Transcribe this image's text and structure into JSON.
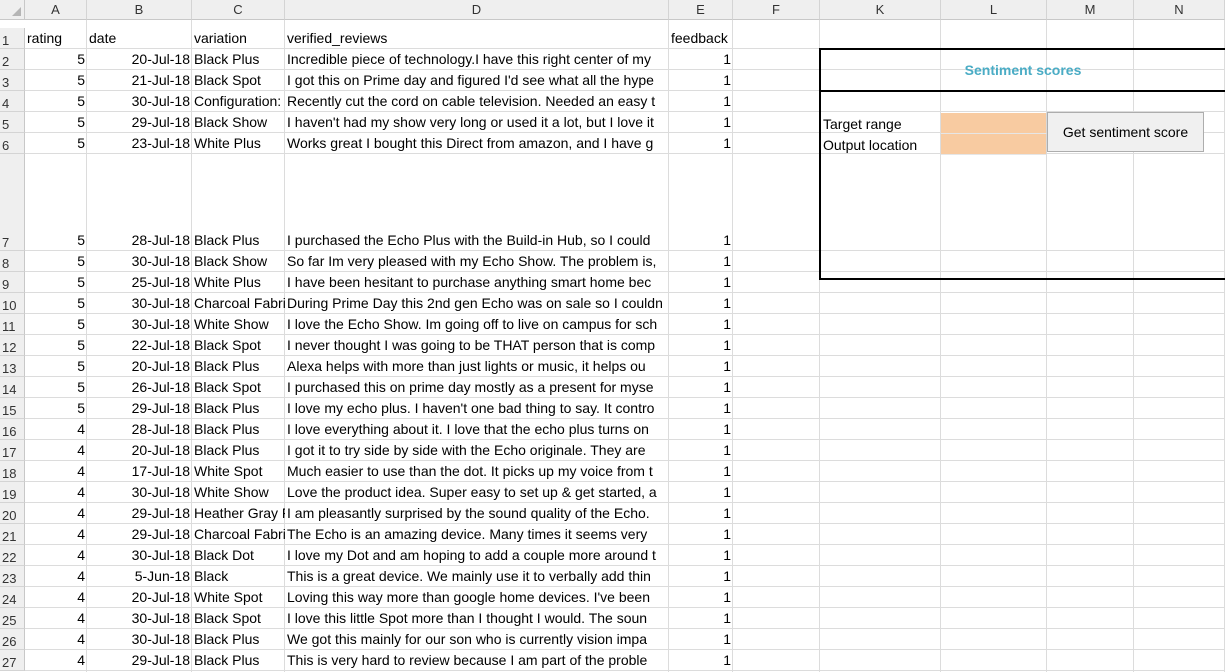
{
  "columns": [
    "A",
    "B",
    "C",
    "D",
    "E",
    "F",
    "K",
    "L",
    "M",
    "N"
  ],
  "rows": [
    {
      "n": "1",
      "a": "rating",
      "b": "date",
      "c": "variation",
      "d": "verified_reviews",
      "e": "feedback"
    },
    {
      "n": "2",
      "a": "5",
      "b": "20-Jul-18",
      "c": "Black  Plus",
      "d": "Incredible piece of technology.I have this right center of my",
      "e": "1"
    },
    {
      "n": "3",
      "a": "5",
      "b": "21-Jul-18",
      "c": "Black  Spot",
      "d": "I got this on Prime day and figured I'd see what all the hype",
      "e": "1"
    },
    {
      "n": "4",
      "a": "5",
      "b": "30-Jul-18",
      "c": "Configuration: Fire TV Stick",
      "d": "Recently cut the cord on cable television. Needed an easy t",
      "e": "1"
    },
    {
      "n": "5",
      "a": "5",
      "b": "29-Jul-18",
      "c": "Black  Show",
      "d": "I haven't had my show very long or used it a lot, but I love it",
      "e": "1"
    },
    {
      "n": "6",
      "a": "5",
      "b": "23-Jul-18",
      "c": "White  Plus",
      "d": "Works great I bought this Direct from amazon, and I have g",
      "e": "1"
    },
    {
      "n": "7",
      "a": "5",
      "b": "28-Jul-18",
      "c": "Black  Plus",
      "d": "I purchased the Echo Plus with the Build-in Hub, so I could",
      "e": "1"
    },
    {
      "n": "8",
      "a": "5",
      "b": "30-Jul-18",
      "c": "Black  Show",
      "d": "So far Im very pleased with my Echo Show.  The problem is,",
      "e": "1"
    },
    {
      "n": "9",
      "a": "5",
      "b": "25-Jul-18",
      "c": "White  Plus",
      "d": "I have been hesitant to purchase anything smart home bec",
      "e": "1"
    },
    {
      "n": "10",
      "a": "5",
      "b": "30-Jul-18",
      "c": "Charcoal Fabric",
      "d": "During Prime Day this 2nd gen Echo was on sale so I couldn",
      "e": "1"
    },
    {
      "n": "11",
      "a": "5",
      "b": "30-Jul-18",
      "c": "White  Show",
      "d": "I love the Echo Show. Im going off to live on campus for sch",
      "e": "1"
    },
    {
      "n": "12",
      "a": "5",
      "b": "22-Jul-18",
      "c": "Black  Spot",
      "d": "I never thought I was going to be THAT person that is comp",
      "e": "1"
    },
    {
      "n": "13",
      "a": "5",
      "b": "20-Jul-18",
      "c": "Black  Plus",
      "d": "Alexa helps with more than just lights or music, it helps ou",
      "e": "1"
    },
    {
      "n": "14",
      "a": "5",
      "b": "26-Jul-18",
      "c": "Black  Spot",
      "d": "I purchased this on prime day mostly as a present for myse",
      "e": "1"
    },
    {
      "n": "15",
      "a": "5",
      "b": "29-Jul-18",
      "c": "Black  Plus",
      "d": "I love my echo plus. I haven't one bad thing to say. It contro",
      "e": "1"
    },
    {
      "n": "16",
      "a": "4",
      "b": "28-Jul-18",
      "c": "Black  Plus",
      "d": "I love everything about it. I love that the echo plus turns on",
      "e": "1"
    },
    {
      "n": "17",
      "a": "4",
      "b": "20-Jul-18",
      "c": "Black  Plus",
      "d": "I got it to try side by side with the Echo originale. They are",
      "e": "1"
    },
    {
      "n": "18",
      "a": "4",
      "b": "17-Jul-18",
      "c": "White  Spot",
      "d": "Much easier to use than the dot. It picks up my voice from t",
      "e": "1"
    },
    {
      "n": "19",
      "a": "4",
      "b": "30-Jul-18",
      "c": "White  Show",
      "d": "Love the product idea. Super easy to set up & get started, a",
      "e": "1"
    },
    {
      "n": "20",
      "a": "4",
      "b": "29-Jul-18",
      "c": "Heather Gray Fabric",
      "d": "I am pleasantly surprised by the sound quality of the Echo.",
      "e": "1"
    },
    {
      "n": "21",
      "a": "4",
      "b": "29-Jul-18",
      "c": "Charcoal Fabric",
      "d": "The Echo is an amazing device.  Many times it seems very",
      "e": "1"
    },
    {
      "n": "22",
      "a": "4",
      "b": "30-Jul-18",
      "c": "Black  Dot",
      "d": "I love my Dot and am hoping to add a couple more around t",
      "e": "1"
    },
    {
      "n": "23",
      "a": "4",
      "b": "5-Jun-18",
      "c": "Black",
      "d": "This is a great device. We mainly use it to verbally add thin",
      "e": "1"
    },
    {
      "n": "24",
      "a": "4",
      "b": "20-Jul-18",
      "c": "White  Spot",
      "d": "Loving this way more than google home devices. I've been",
      "e": "1"
    },
    {
      "n": "25",
      "a": "4",
      "b": "30-Jul-18",
      "c": "Black  Spot",
      "d": "I love this little Spot more than I thought I would. The soun",
      "e": "1"
    },
    {
      "n": "26",
      "a": "4",
      "b": "30-Jul-18",
      "c": "Black  Plus",
      "d": "We got this mainly for our son who is currently vision impa",
      "e": "1"
    },
    {
      "n": "27",
      "a": "4",
      "b": "29-Jul-18",
      "c": "Black  Plus",
      "d": "This is very hard to review because I am part of the proble",
      "e": "1"
    }
  ],
  "panel": {
    "title": "Sentiment scores",
    "target_label": "Target range",
    "output_label": "Output location",
    "button_label": "Get sentiment score",
    "input_color": "#f8cba1",
    "title_color": "#4aacc5"
  }
}
